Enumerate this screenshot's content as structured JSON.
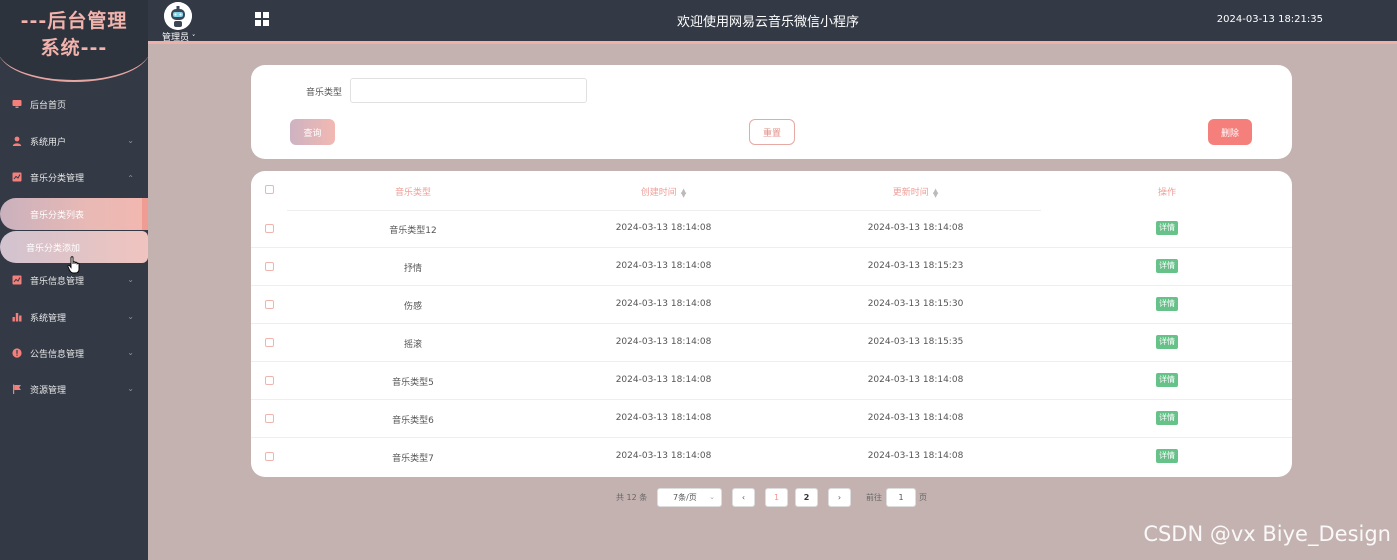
{
  "logo": {
    "line1": "---后台管理",
    "line2": "系统---"
  },
  "sidebar": {
    "items": [
      {
        "label": "后台首页",
        "icon": "monitor-icon"
      },
      {
        "label": "系统用户",
        "icon": "user-icon"
      },
      {
        "label": "音乐分类管理",
        "icon": "chart-icon",
        "expanded": true,
        "children": [
          {
            "label": "音乐分类列表",
            "active": true
          },
          {
            "label": "音乐分类添加",
            "hover": true
          }
        ]
      },
      {
        "label": "音乐信息管理",
        "icon": "chart-icon"
      },
      {
        "label": "系统管理",
        "icon": "bar-chart-icon"
      },
      {
        "label": "公告信息管理",
        "icon": "info-circle-icon"
      },
      {
        "label": "资源管理",
        "icon": "flag-icon"
      }
    ]
  },
  "header": {
    "admin_label": "管理员",
    "title": "欢迎使用网易云音乐微信小程序",
    "datetime": "2024-03-13 18:21:35"
  },
  "search": {
    "label": "音乐类型",
    "value": "",
    "query_button": "查询",
    "reset_button": "重置",
    "delete_button": "删除"
  },
  "table": {
    "columns": [
      "音乐类型",
      "创建时间",
      "更新时间",
      "操作"
    ],
    "rows": [
      {
        "type": "音乐类型12",
        "created": "2024-03-13 18:14:08",
        "updated": "2024-03-13 18:14:08",
        "action": "详情"
      },
      {
        "type": "抒情",
        "created": "2024-03-13 18:14:08",
        "updated": "2024-03-13 18:15:23",
        "action": "详情"
      },
      {
        "type": "伤感",
        "created": "2024-03-13 18:14:08",
        "updated": "2024-03-13 18:15:30",
        "action": "详情"
      },
      {
        "type": "摇滚",
        "created": "2024-03-13 18:14:08",
        "updated": "2024-03-13 18:15:35",
        "action": "详情"
      },
      {
        "type": "音乐类型5",
        "created": "2024-03-13 18:14:08",
        "updated": "2024-03-13 18:14:08",
        "action": "详情"
      },
      {
        "type": "音乐类型6",
        "created": "2024-03-13 18:14:08",
        "updated": "2024-03-13 18:14:08",
        "action": "详情"
      },
      {
        "type": "音乐类型7",
        "created": "2024-03-13 18:14:08",
        "updated": "2024-03-13 18:14:08",
        "action": "详情"
      }
    ]
  },
  "pagination": {
    "total_text": "共 12 条",
    "page_size": "7条/页",
    "pages": [
      "1",
      "2"
    ],
    "current": "1",
    "goto_label": "前往",
    "goto_value": "1",
    "page_suffix": "页"
  },
  "watermark": "CSDN @vx Biye_Design",
  "colors": {
    "sidebar_bg": "#333a45",
    "accent": "#f0b0aa",
    "detail_green": "#67c28a",
    "delete_red": "#f47f7b",
    "content_bg": "#c3b2b0"
  }
}
